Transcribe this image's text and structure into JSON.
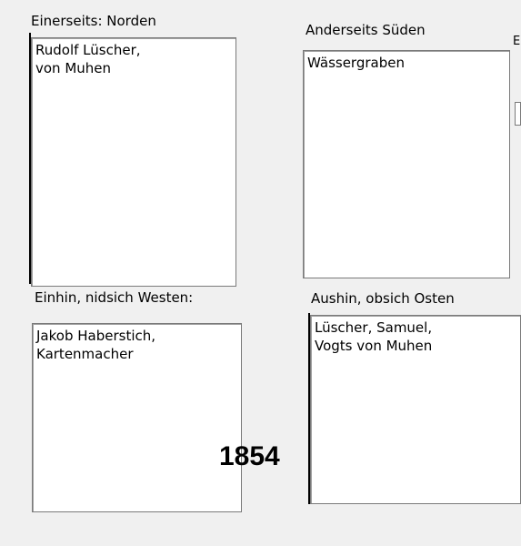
{
  "north": {
    "label": "Einerseits: Norden",
    "text": "Rudolf Lüscher,\nvon Muhen"
  },
  "south": {
    "label": "Anderseits Süden",
    "text": "Wässergraben"
  },
  "west": {
    "label": "Einhin, nidsich Westen:",
    "text": "Jakob Haberstich,\nKartenmacher"
  },
  "east": {
    "label": "Aushin,  obsich Osten",
    "text": "Lüscher, Samuel,\nVogts von Muhen"
  },
  "year": "1854",
  "edge": {
    "glyph": "E"
  }
}
